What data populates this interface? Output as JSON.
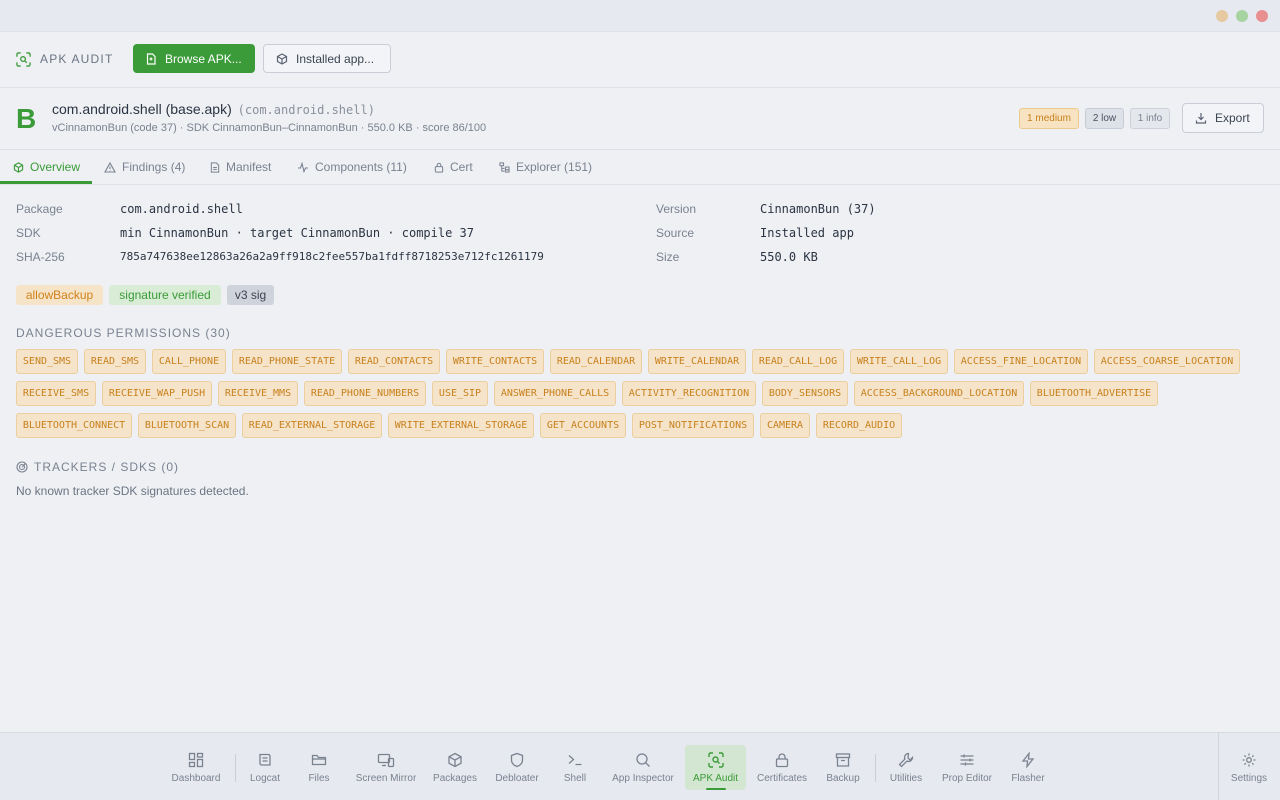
{
  "toolbar": {
    "title": "APK AUDIT",
    "browse_label": "Browse APK...",
    "installed_label": "Installed app..."
  },
  "app": {
    "grade": "B",
    "name": "com.android.shell (base.apk)",
    "package": "(com.android.shell)",
    "meta": "vCinnamonBun (code 37) · SDK CinnamonBun–CinnamonBun · 550.0 KB · score 86/100",
    "severity": {
      "medium": "1 medium",
      "low": "2 low",
      "info": "1 info"
    },
    "export_label": "Export"
  },
  "tabs": [
    {
      "label": "Overview"
    },
    {
      "label": "Findings (4)"
    },
    {
      "label": "Manifest"
    },
    {
      "label": "Components (11)"
    },
    {
      "label": "Cert"
    },
    {
      "label": "Explorer (151)"
    }
  ],
  "overview": {
    "package_label": "Package",
    "package_value": "com.android.shell",
    "sdk_label": "SDK",
    "sdk_value": "min CinnamonBun · target CinnamonBun · compile 37",
    "sha_label": "SHA-256",
    "sha_value": "785a747638ee12863a26a2a9ff918c2fee557ba1fdff8718253e712fc1261179",
    "version_label": "Version",
    "version_value": "CinnamonBun (37)",
    "source_label": "Source",
    "source_value": "Installed app",
    "size_label": "Size",
    "size_value": "550.0 KB"
  },
  "flags": [
    "allowBackup",
    "signature verified",
    "v3 sig"
  ],
  "permissions_title": "DANGEROUS PERMISSIONS (30)",
  "permissions": [
    "SEND_SMS",
    "READ_SMS",
    "CALL_PHONE",
    "READ_PHONE_STATE",
    "READ_CONTACTS",
    "WRITE_CONTACTS",
    "READ_CALENDAR",
    "WRITE_CALENDAR",
    "READ_CALL_LOG",
    "WRITE_CALL_LOG",
    "ACCESS_FINE_LOCATION",
    "ACCESS_COARSE_LOCATION",
    "RECEIVE_SMS",
    "RECEIVE_WAP_PUSH",
    "RECEIVE_MMS",
    "READ_PHONE_NUMBERS",
    "USE_SIP",
    "ANSWER_PHONE_CALLS",
    "ACTIVITY_RECOGNITION",
    "BODY_SENSORS",
    "ACCESS_BACKGROUND_LOCATION",
    "BLUETOOTH_ADVERTISE",
    "BLUETOOTH_CONNECT",
    "BLUETOOTH_SCAN",
    "READ_EXTERNAL_STORAGE",
    "WRITE_EXTERNAL_STORAGE",
    "GET_ACCOUNTS",
    "POST_NOTIFICATIONS",
    "CAMERA",
    "RECORD_AUDIO"
  ],
  "trackers": {
    "title": "TRACKERS / SDKS (0)",
    "note": "No known tracker SDK signatures detected."
  },
  "dock": [
    {
      "label": "Dashboard",
      "icon": "grid-icon"
    },
    {
      "label": "Logcat",
      "icon": "logcat-icon"
    },
    {
      "label": "Files",
      "icon": "folder-icon"
    },
    {
      "label": "Screen Mirror",
      "icon": "screen-mirror-icon"
    },
    {
      "label": "Packages",
      "icon": "package-icon"
    },
    {
      "label": "Debloater",
      "icon": "shield-icon"
    },
    {
      "label": "Shell",
      "icon": "terminal-icon"
    },
    {
      "label": "App Inspector",
      "icon": "search-icon"
    },
    {
      "label": "APK Audit",
      "icon": "scan-icon"
    },
    {
      "label": "Certificates",
      "icon": "lock-icon"
    },
    {
      "label": "Backup",
      "icon": "archive-icon"
    },
    {
      "label": "Utilities",
      "icon": "wrench-icon"
    },
    {
      "label": "Prop Editor",
      "icon": "sliders-icon"
    },
    {
      "label": "Flasher",
      "icon": "bolt-icon"
    },
    {
      "label": "Settings",
      "icon": "gear-icon"
    }
  ],
  "colors": {
    "accent": "#3a9b38",
    "warning": "#c8801d",
    "background": "#eef0f4"
  }
}
